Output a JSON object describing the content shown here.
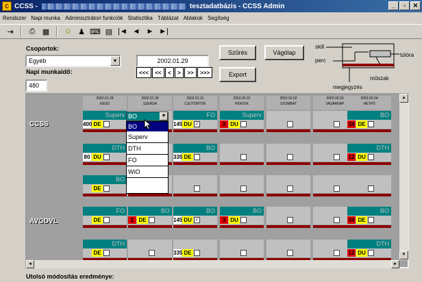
{
  "window": {
    "app_label": "CCSS -",
    "title": "tesztadatbázis - CCSS Admin",
    "min": "_",
    "max": "▫",
    "close": "✕"
  },
  "menu": [
    "Rendszer",
    "Napi munka",
    "Adminisztrátori funkciók",
    "Statisztika",
    "Táblázat",
    "Ablakok",
    "Segítség"
  ],
  "toolbar": {
    "nav": [
      "|◄",
      "◄",
      "►",
      "►|"
    ]
  },
  "form": {
    "csoportok_label": "Csoportok:",
    "csoportok_value": "Egyéb",
    "napi_label": "Napi munkaidő:",
    "napi_value": "480",
    "date_value": "2002.01.29",
    "nav_buttons": [
      "<<<",
      "<<",
      "<",
      ">",
      ">>",
      ">>>"
    ],
    "szures_label": "Szűrés",
    "vagolap_label": "Vágólap",
    "export_label": "Export"
  },
  "legend": {
    "skill": "skill",
    "perc": "perc",
    "tulora": "túlóra",
    "muszak": "műszak",
    "megjegyzes": "megjegyzés"
  },
  "days": [
    {
      "date": "2002.01.28",
      "name": "KEDD"
    },
    {
      "date": "2002.01.30",
      "name": "SZERDA"
    },
    {
      "date": "2002.01.31",
      "name": "CSÜTÖRTÖK"
    },
    {
      "date": "2002.02.01",
      "name": "PÉNTEK"
    },
    {
      "date": "2002.02.02",
      "name": "SZOMBAT"
    },
    {
      "date": "2002.02.03",
      "name": "VASÁRNAP"
    },
    {
      "date": "2002.02.04",
      "name": "HÉTFŐ"
    }
  ],
  "groups": [
    "CCSS",
    "AVGDVL"
  ],
  "dropdown": {
    "selected": "BO",
    "options": [
      "BO",
      "Superv",
      "DTH",
      "FO",
      "WiO"
    ]
  },
  "rows": {
    "r1": [
      {
        "skill": "Superv",
        "num": "400",
        "shift": "DE"
      },
      {
        "skill": "",
        "num": "",
        "shift": ""
      },
      {
        "skill": "FO",
        "num": "145",
        "shift": "DU",
        "check": "✓"
      },
      {
        "skill": "Superv",
        "num": "3",
        "shift": "DU"
      },
      {
        "skill": "",
        "num": "",
        "shift": ""
      },
      {
        "skill": "",
        "num": "",
        "shift": ""
      },
      {
        "skill": "BO",
        "num": "34",
        "shift": "DE"
      }
    ],
    "r2": [
      {
        "skill": "DTH",
        "num": "80",
        "shift": "DU"
      },
      {
        "skill": "",
        "num": "",
        "shift": ""
      },
      {
        "skill": "BO",
        "num": "335",
        "shift": "DE"
      },
      {
        "skill": "",
        "num": "",
        "shift": ""
      },
      {
        "skill": "",
        "num": "",
        "shift": ""
      },
      {
        "skill": "",
        "num": "",
        "shift": ""
      },
      {
        "skill": "DTH",
        "num": "12",
        "shift": "DU"
      }
    ],
    "r3": [
      {
        "skill": "BO",
        "num": "",
        "shift": "DE"
      },
      {
        "skill": "",
        "num": "",
        "shift": ""
      },
      {
        "skill": "",
        "num": "",
        "shift": ""
      },
      {
        "skill": "",
        "num": "",
        "shift": ""
      },
      {
        "skill": "",
        "num": "",
        "shift": ""
      },
      {
        "skill": "",
        "num": "",
        "shift": ""
      },
      {
        "skill": "",
        "num": "",
        "shift": ""
      }
    ],
    "r4": [
      {
        "skill": "FO",
        "num": "",
        "shift": "DE"
      },
      {
        "skill": "BO",
        "num": "2",
        "shift": "DE"
      },
      {
        "skill": "BO",
        "num": "145",
        "shift": "DU",
        "check": "✓"
      },
      {
        "skill": "BO",
        "num": "3",
        "shift": "DU"
      },
      {
        "skill": "",
        "num": "",
        "shift": ""
      },
      {
        "skill": "",
        "num": "",
        "shift": ""
      },
      {
        "skill": "BO",
        "num": "34",
        "shift": "DE"
      }
    ],
    "r5": [
      {
        "skill": "DTH",
        "num": "",
        "shift": "DE"
      },
      {
        "skill": "",
        "num": "",
        "shift": ""
      },
      {
        "skill": "",
        "num": "335",
        "shift": "DE"
      },
      {
        "skill": "",
        "num": "",
        "shift": ""
      },
      {
        "skill": "",
        "num": "",
        "shift": ""
      },
      {
        "skill": "",
        "num": "",
        "shift": ""
      },
      {
        "skill": "DTH",
        "num": "12",
        "shift": "DU"
      }
    ]
  },
  "footer_label": "Utolsó módosítás eredménye:"
}
